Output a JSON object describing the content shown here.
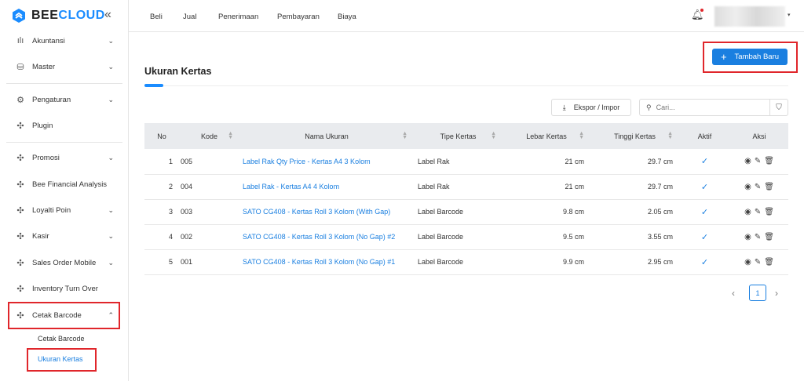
{
  "brand": {
    "logo_text_dark": "BEE",
    "logo_text_blue": "CLOUD",
    "accent": "#1a8cff"
  },
  "sidebar": {
    "items": [
      {
        "label": "Akuntansi",
        "icon": "bar-chart-icon",
        "chevron": "down"
      },
      {
        "label": "Master",
        "icon": "database-icon",
        "chevron": "down"
      },
      {
        "label": "Pengaturan",
        "icon": "gear-icon",
        "chevron": "down"
      },
      {
        "label": "Plugin",
        "icon": "puzzle-icon"
      },
      {
        "label": "Promosi",
        "icon": "puzzle-icon",
        "chevron": "down"
      },
      {
        "label": "Bee Financial Analysis",
        "icon": "puzzle-icon"
      },
      {
        "label": "Loyalti Poin",
        "icon": "puzzle-icon",
        "chevron": "down"
      },
      {
        "label": "Kasir",
        "icon": "puzzle-icon",
        "chevron": "down"
      },
      {
        "label": "Sales Order Mobile",
        "icon": "puzzle-icon",
        "chevron": "down"
      },
      {
        "label": "Inventory Turn Over",
        "icon": "puzzle-icon"
      },
      {
        "label": "Cetak Barcode",
        "icon": "puzzle-icon",
        "chevron": "up"
      }
    ],
    "subitems": [
      {
        "label": "Cetak Barcode"
      },
      {
        "label": "Ukuran Kertas",
        "active": true
      }
    ]
  },
  "topnav": [
    "Beli",
    "Jual",
    "Penerimaan",
    "Pembayaran",
    "Biaya"
  ],
  "page": {
    "title": "Ukuran Kertas",
    "add_label": "Tambah Baru",
    "export_label": "Ekspor / Impor",
    "search_placeholder": "Cari..."
  },
  "table": {
    "headers": [
      "No",
      "Kode",
      "Nama Ukuran",
      "Tipe Kertas",
      "Lebar Kertas",
      "Tinggi Kertas",
      "Aktif",
      "Aksi"
    ],
    "rows": [
      {
        "no": "1",
        "kode": "005",
        "nama": "Label Rak Qty Price - Kertas A4 3 Kolom",
        "tipe": "Label Rak",
        "lebar": "21 cm",
        "tinggi": "29.7 cm",
        "aktif": true
      },
      {
        "no": "2",
        "kode": "004",
        "nama": "Label Rak - Kertas A4 4 Kolom",
        "tipe": "Label Rak",
        "lebar": "21 cm",
        "tinggi": "29.7 cm",
        "aktif": true
      },
      {
        "no": "3",
        "kode": "003",
        "nama": "SATO CG408 - Kertas Roll 3 Kolom (With Gap)",
        "tipe": "Label Barcode",
        "lebar": "9.8 cm",
        "tinggi": "2.05 cm",
        "aktif": true
      },
      {
        "no": "4",
        "kode": "002",
        "nama": "SATO CG408 - Kertas Roll 3 Kolom (No Gap) #2",
        "tipe": "Label Barcode",
        "lebar": "9.5 cm",
        "tinggi": "3.55 cm",
        "aktif": true
      },
      {
        "no": "5",
        "kode": "001",
        "nama": "SATO CG408 - Kertas Roll 3 Kolom (No Gap) #1",
        "tipe": "Label Barcode",
        "lebar": "9.9 cm",
        "tinggi": "2.95 cm",
        "aktif": true
      }
    ]
  },
  "pagination": {
    "current": "1"
  }
}
